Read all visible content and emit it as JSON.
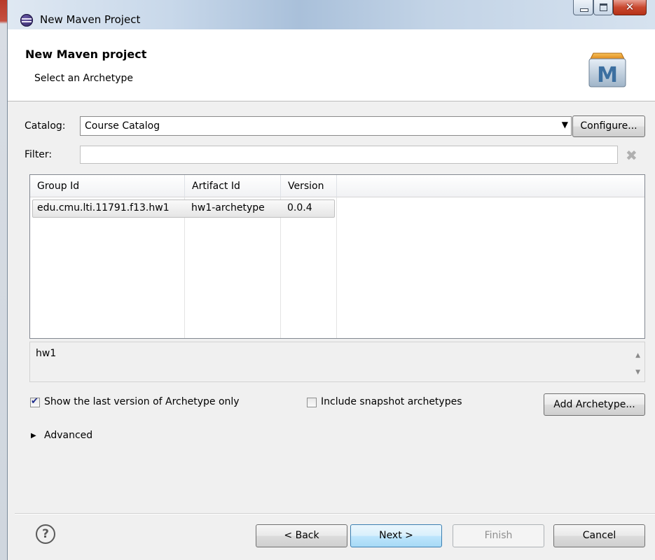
{
  "window": {
    "title": "New Maven Project"
  },
  "header": {
    "title": "New Maven project",
    "subtitle": "Select an Archetype",
    "logo_letter": "M"
  },
  "catalog": {
    "label": "Catalog:",
    "selected": "Course Catalog",
    "configure_label": "Configure..."
  },
  "filter": {
    "label": "Filter:",
    "value": "",
    "clear_icon": "clear-icon"
  },
  "table": {
    "columns": [
      "Group Id",
      "Artifact Id",
      "Version"
    ],
    "rows": [
      {
        "group_id": "edu.cmu.lti.11791.f13.hw1",
        "artifact_id": "hw1-archetype",
        "version": "0.0.4"
      }
    ]
  },
  "description": {
    "text": "hw1"
  },
  "options": {
    "last_version_label": "Show the last version of Archetype only",
    "last_version_checked": true,
    "snapshot_label": "Include snapshot archetypes",
    "snapshot_checked": false,
    "add_archetype_label": "Add Archetype..."
  },
  "advanced": {
    "label": "Advanced"
  },
  "footer": {
    "back_label": "< Back",
    "next_label": "Next >",
    "finish_label": "Finish",
    "cancel_label": "Cancel"
  },
  "colors": {
    "primary_button_border": "#3c7fb1",
    "disabled_text": "#8f8f8f"
  }
}
